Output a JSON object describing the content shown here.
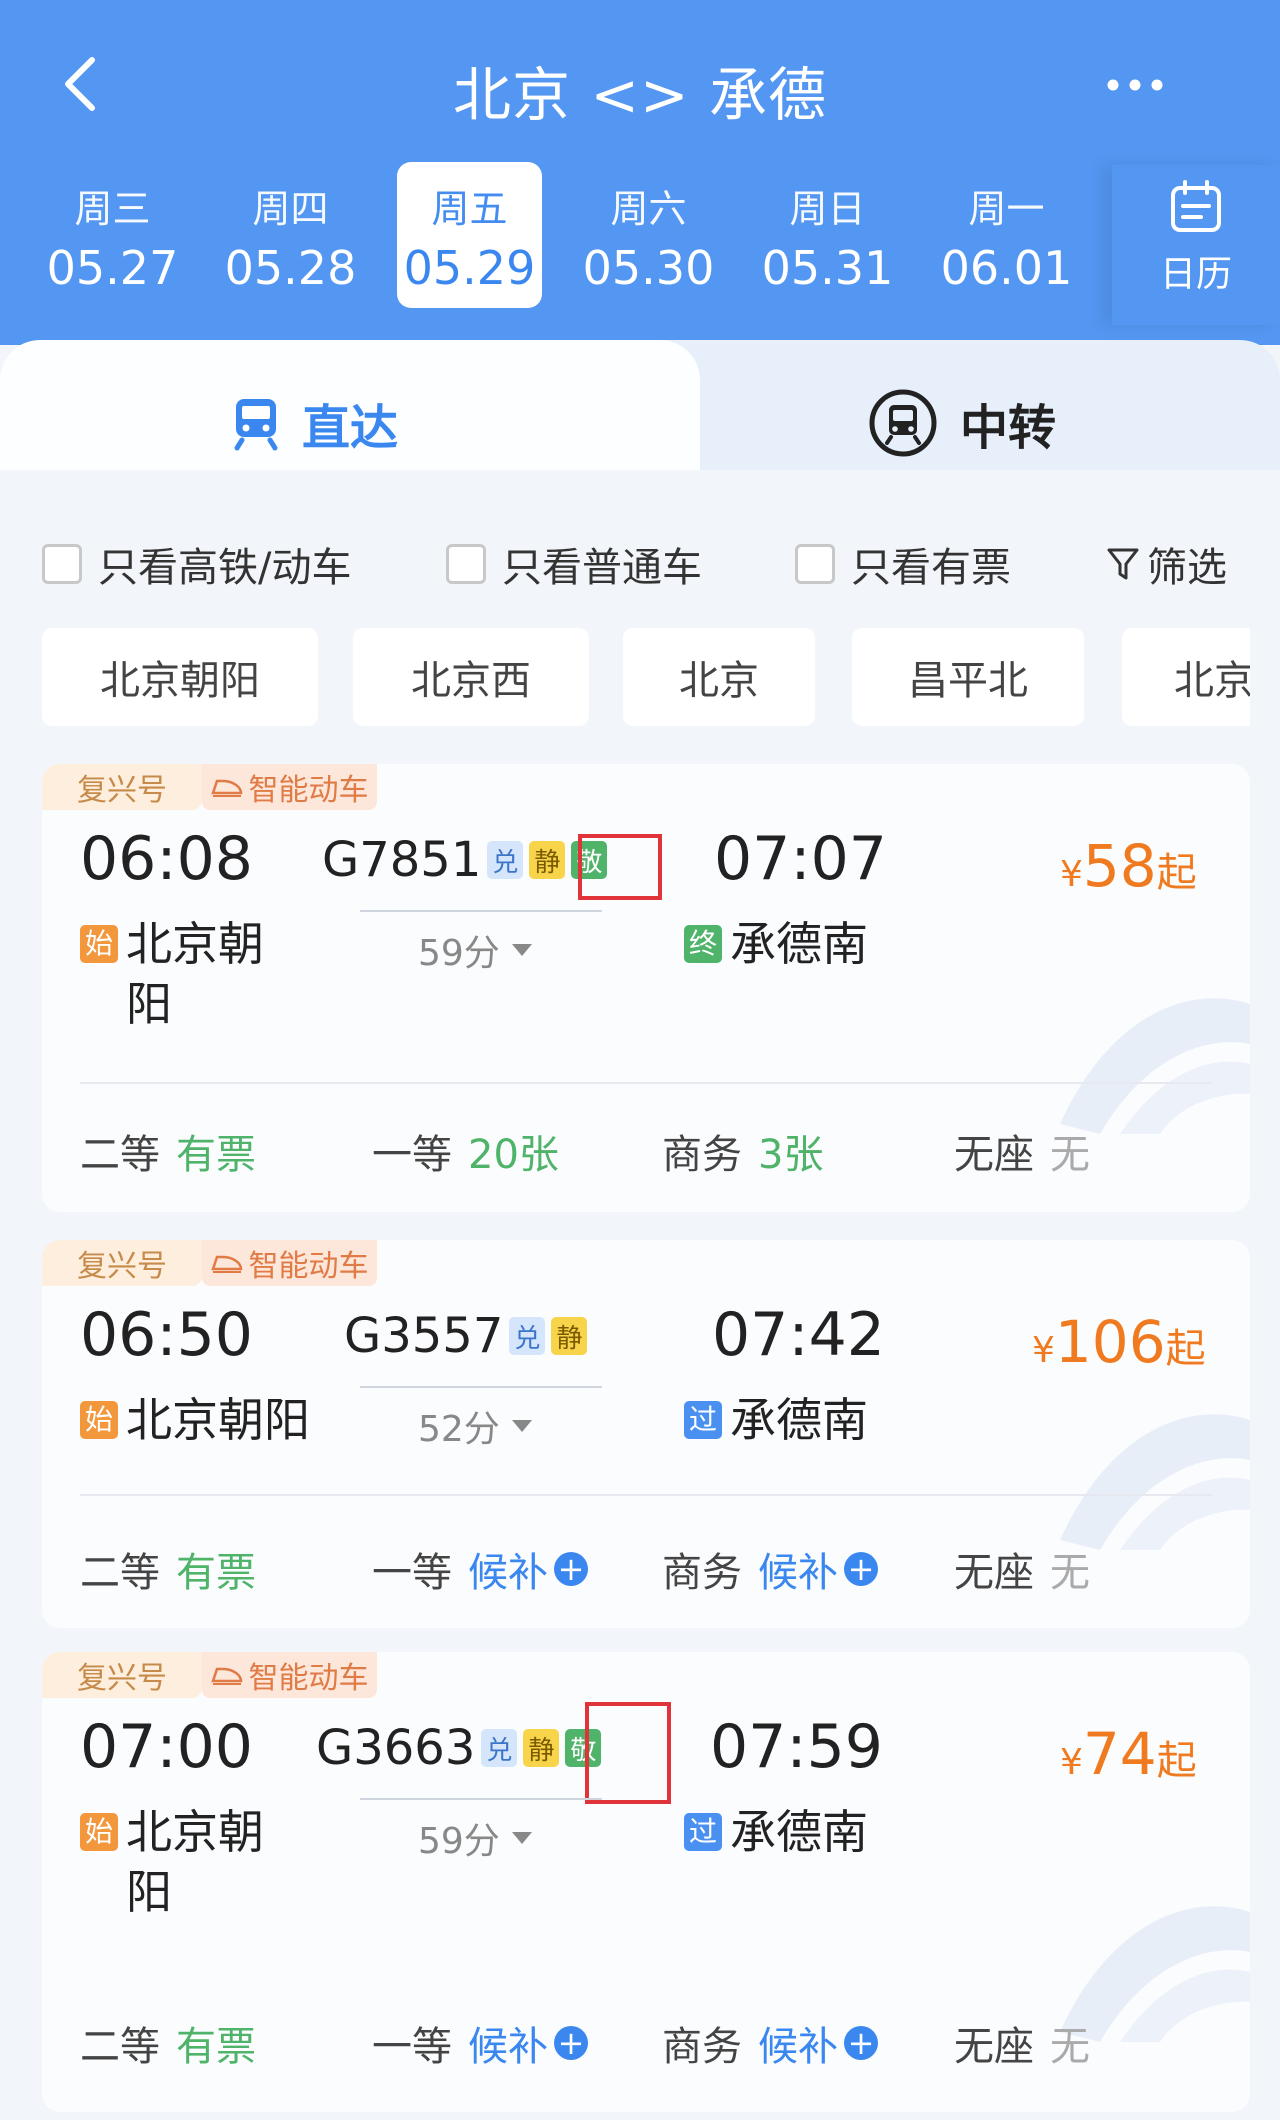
{
  "header": {
    "title": "北京 <> 承德",
    "dates": [
      {
        "weekday": "周三",
        "date": "05.27"
      },
      {
        "weekday": "周四",
        "date": "05.28"
      },
      {
        "weekday": "周五",
        "date": "05.29"
      },
      {
        "weekday": "周六",
        "date": "05.30"
      },
      {
        "weekday": "周日",
        "date": "05.31"
      },
      {
        "weekday": "周一",
        "date": "06.01"
      }
    ],
    "selected_date_index": 2,
    "calendar_label": "日历"
  },
  "tabs": {
    "direct": "直达",
    "transfer": "中转"
  },
  "filters": {
    "high_speed": "只看高铁/动车",
    "normal": "只看普通车",
    "has_ticket": "只看有票",
    "filter": "筛选"
  },
  "stations": [
    "北京朝阳",
    "北京西",
    "北京",
    "昌平北",
    "北京"
  ],
  "trains": [
    {
      "badge1": "复兴号",
      "badge2": "智能动车",
      "dep_time": "06:08",
      "train_no": "G7851",
      "tags": [
        "兑",
        "静",
        "敬"
      ],
      "arr_time": "07:07",
      "duration": "59分",
      "from_tag": "始",
      "from": "北京朝阳",
      "to_tag": "终",
      "to": "承德南",
      "price_yen": "¥",
      "price": "58",
      "price_suffix": "起",
      "seats": [
        {
          "cls": "二等",
          "val": "有票",
          "kind": "avail"
        },
        {
          "cls": "一等",
          "val": "20张",
          "kind": "avail"
        },
        {
          "cls": "商务",
          "val": "3张",
          "kind": "avail"
        },
        {
          "cls": "无座",
          "val": "无",
          "kind": "none"
        }
      ]
    },
    {
      "badge1": "复兴号",
      "badge2": "智能动车",
      "dep_time": "06:50",
      "train_no": "G3557",
      "tags": [
        "兑",
        "静"
      ],
      "arr_time": "07:42",
      "duration": "52分",
      "from_tag": "始",
      "from": "北京朝阳",
      "to_tag": "过",
      "to": "承德南",
      "price_yen": "¥",
      "price": "106",
      "price_suffix": "起",
      "seats": [
        {
          "cls": "二等",
          "val": "有票",
          "kind": "avail"
        },
        {
          "cls": "一等",
          "val": "候补",
          "kind": "wait"
        },
        {
          "cls": "商务",
          "val": "候补",
          "kind": "wait"
        },
        {
          "cls": "无座",
          "val": "无",
          "kind": "none"
        }
      ]
    },
    {
      "badge1": "复兴号",
      "badge2": "智能动车",
      "dep_time": "07:00",
      "train_no": "G3663",
      "tags": [
        "兑",
        "静",
        "敬"
      ],
      "arr_time": "07:59",
      "duration": "59分",
      "from_tag": "始",
      "from": "北京朝阳",
      "to_tag": "过",
      "to": "承德南",
      "price_yen": "¥",
      "price": "74",
      "price_suffix": "起",
      "seats": [
        {
          "cls": "二等",
          "val": "有票",
          "kind": "avail"
        },
        {
          "cls": "一等",
          "val": "候补",
          "kind": "wait"
        },
        {
          "cls": "商务",
          "val": "候补",
          "kind": "wait"
        },
        {
          "cls": "无座",
          "val": "无",
          "kind": "none"
        }
      ]
    }
  ],
  "colors": {
    "header_blue": "#5397f2",
    "accent_blue": "#3b87f0",
    "price_orange": "#f07a1f",
    "available_green": "#4fb36a",
    "highlight_red": "#e0343a"
  }
}
